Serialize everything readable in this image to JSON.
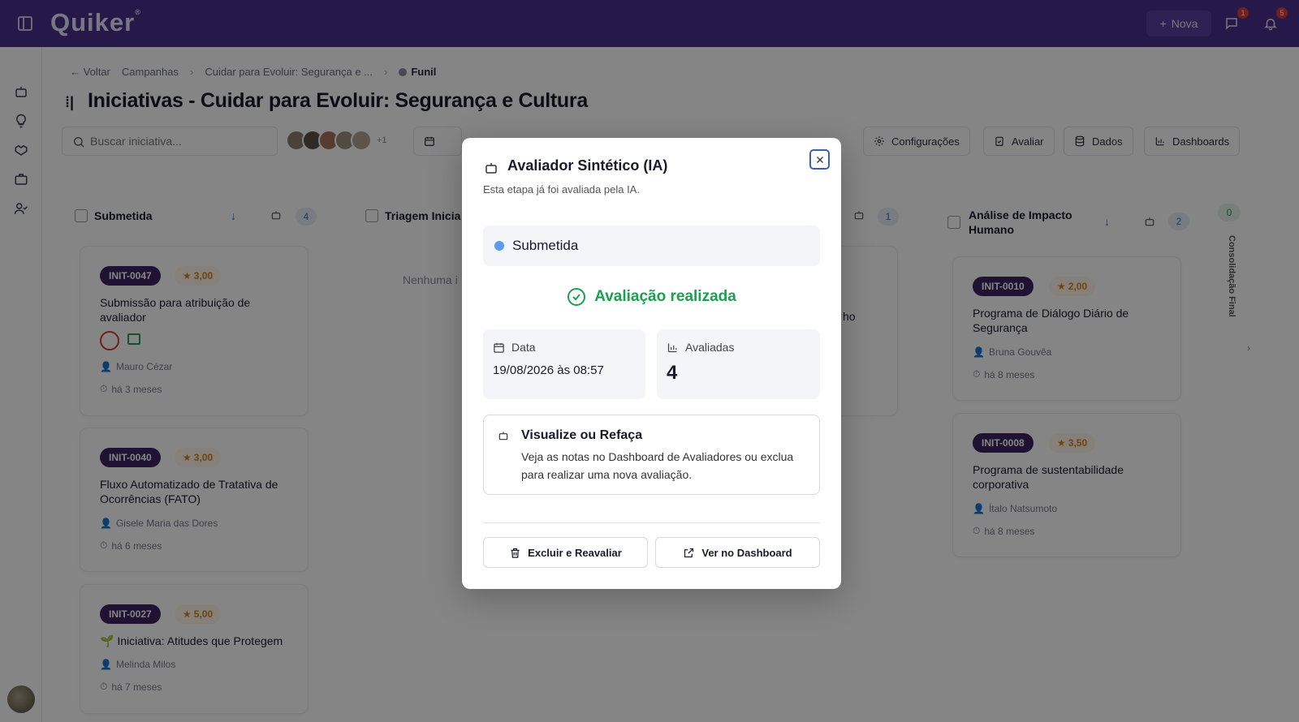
{
  "app": {
    "brand": "Quiker",
    "nova_label": "Nova",
    "chat_badge": "1",
    "bell_badge": "5"
  },
  "breadcrumb": {
    "back": "Voltar",
    "items": [
      "Campanhas",
      "Cuidar para Evoluir: Segurança e ..."
    ],
    "current": "Funil"
  },
  "page": {
    "title": "Iniciativas - Cuidar para Evoluir: Segurança e Cultura"
  },
  "toolbar": {
    "search_placeholder": "Buscar iniciativa...",
    "avatars_more": "+1",
    "config": "Configurações",
    "avaliar": "Avaliar",
    "dados": "Dados",
    "dashboards": "Dashboards"
  },
  "columns": [
    {
      "title": "Submetida",
      "count": "4"
    },
    {
      "title": "Triagem Inicia",
      "count": "1",
      "empty": "Nenhuma i"
    },
    {
      "title": "Análise de Impacto Humano",
      "count": "2"
    },
    {
      "title": "Consolidação Final",
      "count": "0"
    }
  ],
  "cards_col1": [
    {
      "id": "INIT-0047",
      "score": "3,00",
      "title": "Submissão para atribuição de avaliador",
      "author": "Mauro Cézar",
      "time": "há 3 meses"
    },
    {
      "id": "INIT-0040",
      "score": "3,00",
      "title": "Fluxo Automatizado de Tratativa de Ocorrências (FATO)",
      "author": "Gisele Maria das Dores",
      "time": "há 6 meses"
    },
    {
      "id": "INIT-0027",
      "score": "5,00",
      "title": "🌱 Iniciativa: Atitudes que Protegem",
      "author": "Melinda Milos",
      "time": "há 7 meses"
    }
  ],
  "cards_col3": [
    {
      "id": "INIT-0010",
      "score": "2,00",
      "title": "Programa de Diálogo Diário de Segurança",
      "author": "Bruna Gouvêa",
      "time": "há 8 meses"
    },
    {
      "id": "INIT-0008",
      "score": "3,50",
      "title": "Programa de sustentabilidade corporativa",
      "author": "Ítalo Natsumoto",
      "time": "há 8 meses"
    }
  ],
  "hidden_fragment": "ho",
  "modal": {
    "title": "Avaliador Sintético (IA)",
    "subtitle": "Esta etapa já foi avaliada pela IA.",
    "stage": "Submetida",
    "status": "Avaliação realizada",
    "date_label": "Data",
    "date_value": "19/08/2026 às 08:57",
    "evaluated_label": "Avaliadas",
    "evaluated_value": "4",
    "notice_title": "Visualize ou Refaça",
    "notice_text": "Veja as notas no Dashboard de Avaliadores ou exclua para realizar uma nova avaliação.",
    "btn_delete": "Excluir e Reavaliar",
    "btn_dashboard": "Ver no Dashboard"
  },
  "colors": {
    "topbar": "#4a2f8c",
    "tag": "#3d2363",
    "success": "#19a150",
    "stage_dot": "#5b9cf0"
  }
}
